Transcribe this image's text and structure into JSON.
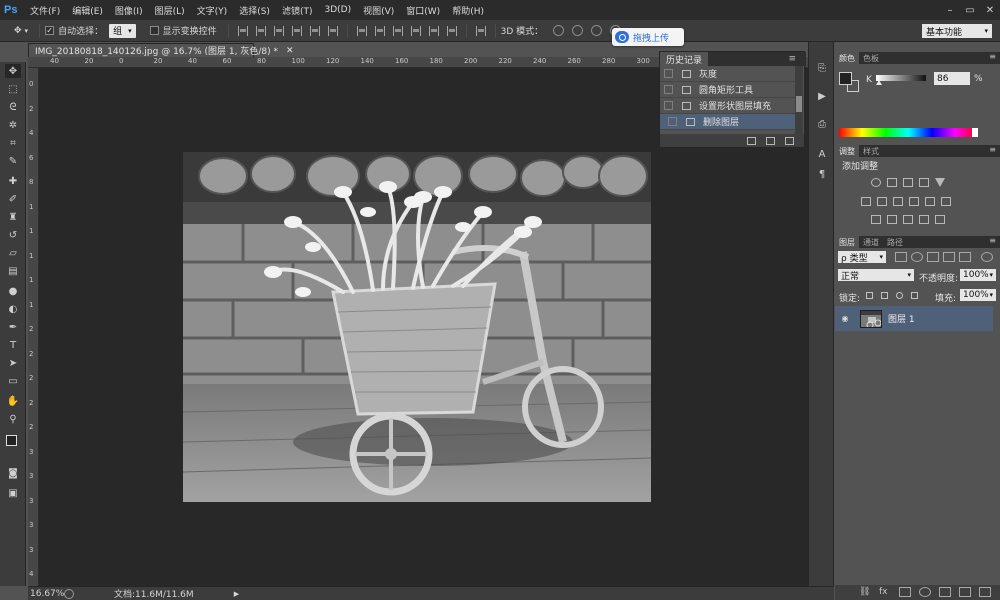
{
  "app": {
    "logo": "Ps"
  },
  "menus": [
    "文件(F)",
    "编辑(E)",
    "图像(I)",
    "图层(L)",
    "文字(Y)",
    "选择(S)",
    "滤镜(T)",
    "3D(D)",
    "视图(V)",
    "窗口(W)",
    "帮助(H)"
  ],
  "options_bar": {
    "auto_select_label": "自动选择：",
    "auto_select_value": "组",
    "show_transform_label": "显示变换控件",
    "mode_3d_label": "3D 模式：",
    "upload_label": "拖拽上传",
    "workspace": "基本功能"
  },
  "document": {
    "tab_title": "IMG_20180818_140126.jpg @ 16.7% (图层 1, 灰色/8) *",
    "zoom": "16.67%",
    "doc_size": "文档:11.6M/11.6M"
  },
  "rulers": {
    "top": [
      "40",
      "20",
      "0",
      "20",
      "40",
      "60",
      "80",
      "100",
      "120",
      "140",
      "160",
      "180",
      "200",
      "220",
      "240",
      "260",
      "280",
      "300",
      "320",
      "340",
      "360",
      "380",
      "400"
    ],
    "left": [
      "0",
      "2",
      "4",
      "6",
      "8",
      "1",
      "1",
      "1",
      "1",
      "1",
      "2",
      "2",
      "2",
      "2",
      "2",
      "3",
      "3",
      "3",
      "3",
      "3",
      "4"
    ]
  },
  "history": {
    "tab": "历史记录",
    "items": [
      {
        "label": "灰度",
        "selected": false
      },
      {
        "label": "圆角矩形工具",
        "selected": false
      },
      {
        "label": "设置形状图层填充",
        "selected": false
      },
      {
        "label": "删除图层",
        "selected": true
      }
    ]
  },
  "color_panel": {
    "tabs": [
      "颜色",
      "色板"
    ],
    "channel": "K",
    "value": "86",
    "unit": "%"
  },
  "adjustments_panel": {
    "tabs": [
      "调整",
      "样式"
    ],
    "title": "添加调整"
  },
  "layers_panel": {
    "tabs": [
      "图层",
      "通道",
      "路径"
    ],
    "filter_label": "ρ 类型",
    "blend_mode": "正常",
    "opacity_label": "不透明度:",
    "opacity_value": "100%",
    "lock_label": "锁定:",
    "fill_label": "填充:",
    "fill_value": "100%",
    "layers": [
      {
        "name": "图层 1",
        "visible": true
      }
    ]
  },
  "colors": {
    "selection": "#4f6079",
    "accent": "#2f6fd6"
  }
}
